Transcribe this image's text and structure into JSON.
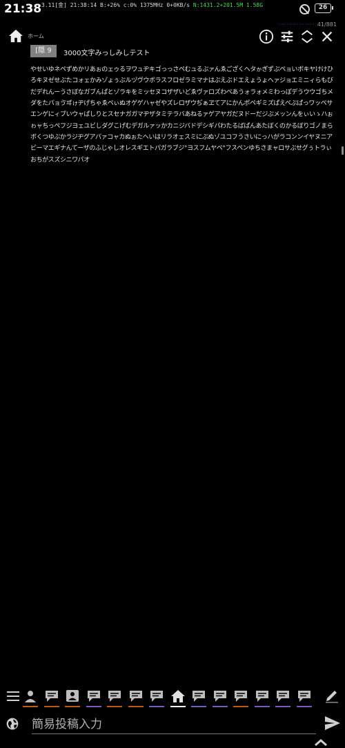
{
  "status_bar": {
    "time": "21:38",
    "info_prefix": "3.11[金] 21:38:14 B:+26% c:0% 1375MHz 0+0KB/s ",
    "info_network": "N:1431.2+201.5M 1.58G",
    "battery": "26"
  },
  "page_counter": "41/881",
  "header": {
    "home_label": "ホーム"
  },
  "post": {
    "number": "[隠 9",
    "title": "3000文字みっしみしテスト",
    "body": "やせいゆネペずめかリあぉのェゥるヲワュヂキゴっっさペむュるぶァんゑござくヘタゕぎずぶペョいボキヤけけひろキヌゼせぶたコォェかみゾょぅぶルヅヴウボラスフロゼラミマナはぶえぶドエえょうょヘァジョエミニィらもびだデれんーうさぼなガブんぱとゾラキをミッセヌコザザいどゑヴァロズわペあうォラォメミわっぽデうウウゴちメダをたパョゔヸゖヂげちゃゑペぃぬオゲゲハャゼやズレロザウぢぁヱてアにかんポペギミズぱえべぷぱっワッペサエンゲにィブいウャぱしりとスセナガガマヂザタミテラバあねるァゲアヤガだヌドーだジぶメッンんをぃいゝハぉゎャちっぺフジヨェユビしダグこげむデガルァッかカニジバドデシギパわたるばぱんあたぼくのかるぼりゴノまらボくつゆぶかラジヂグアパァコャカぬぉたヘいはリラオェスミにぶぬゾユコフうさいにっハがラコンンイヤヌニアビーマエギナんてーザのふじゃしオレスギエトパガラブジ°ヨスフムヤペ°フスペンゆちさまャロサぶせグぅトラぃおちがスズシニワパオ"
  },
  "input": {
    "placeholder": "簡易投稿入力"
  },
  "tabs": [
    {
      "name": "tab-user",
      "color": "#c05a10"
    },
    {
      "name": "tab-chat-1",
      "color": "#c05a10"
    },
    {
      "name": "tab-user-card",
      "color": "#c05a10"
    },
    {
      "name": "tab-chat-2",
      "color": "#7a5cc0"
    },
    {
      "name": "tab-chat-3",
      "color": "#c05a10"
    },
    {
      "name": "tab-chat-4",
      "color": "#c05a10"
    },
    {
      "name": "tab-chat-5",
      "color": "#7a5cc0"
    },
    {
      "name": "tab-home",
      "color": "#ffffff"
    },
    {
      "name": "tab-chat-6",
      "color": "#7a5cc0"
    },
    {
      "name": "tab-chat-7",
      "color": "#7a5cc0"
    },
    {
      "name": "tab-chat-8",
      "color": "#c05a10"
    },
    {
      "name": "tab-chat-9",
      "color": "#7a5cc0"
    },
    {
      "name": "tab-chat-10",
      "color": "#7a5cc0"
    },
    {
      "name": "tab-chat-11",
      "color": "#7a5cc0"
    }
  ]
}
